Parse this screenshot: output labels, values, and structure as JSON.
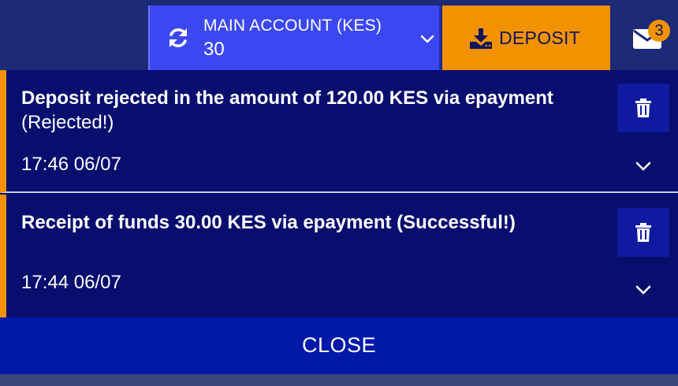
{
  "header": {
    "account_label": "MAIN ACCOUNT (KES)",
    "account_balance": "30",
    "deposit_label": "DEPOSIT",
    "message_count": "3",
    "icons": [
      "refresh-icon",
      "chevron-down-icon",
      "download-icon",
      "envelope-icon"
    ]
  },
  "notifications": [
    {
      "title": "Deposit rejected in the amount of 120.00 KES via epayment",
      "status": "(Rejected!)",
      "time": "17:46 06/07"
    },
    {
      "title": "Receipt of funds 30.00 KES via epayment (Successful!)",
      "status": "",
      "time": "17:44 06/07"
    }
  ],
  "footer": {
    "close_label": "CLOSE"
  },
  "colors": {
    "accent_orange": "#f39200",
    "account_blue": "#3b48f2",
    "panel_navy": "#080e6e",
    "close_blue": "#0019a8"
  }
}
